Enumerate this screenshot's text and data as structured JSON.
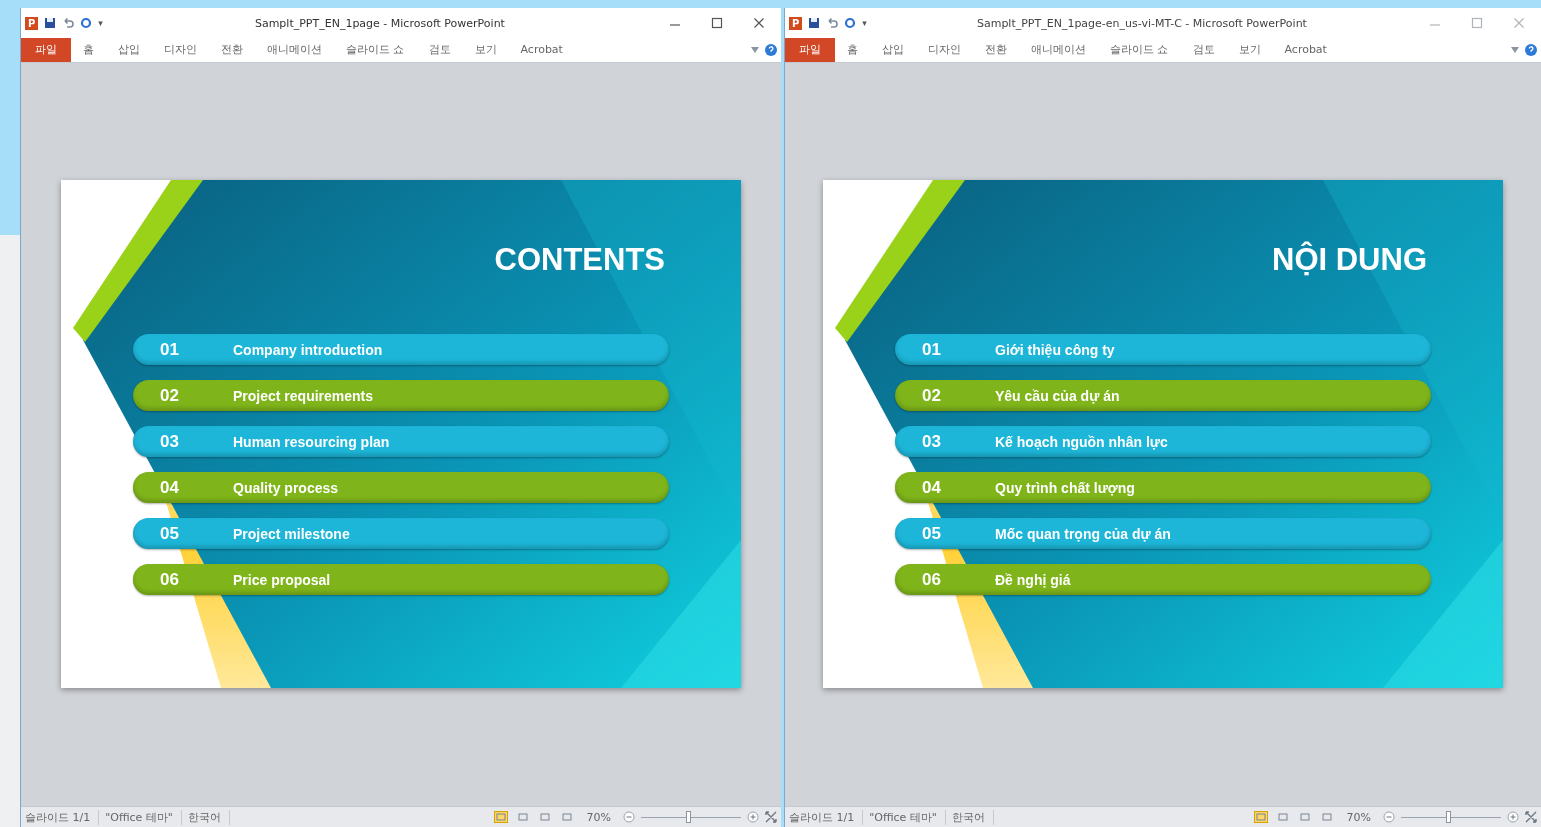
{
  "windows": [
    {
      "active": true,
      "app_icon": "P",
      "quick_access_more": "▾",
      "title": "Samplt_PPT_EN_1page - Microsoft PowerPoint",
      "ribbon_tabs": [
        {
          "label": "파일",
          "selected": true
        },
        {
          "label": "홈",
          "selected": false
        },
        {
          "label": "삽입",
          "selected": false
        },
        {
          "label": "디자인",
          "selected": false
        },
        {
          "label": "전환",
          "selected": false
        },
        {
          "label": "애니메이션",
          "selected": false
        },
        {
          "label": "슬라이드 쇼",
          "selected": false
        },
        {
          "label": "검토",
          "selected": false
        },
        {
          "label": "보기",
          "selected": false
        },
        {
          "label": "Acrobat",
          "selected": false
        }
      ],
      "slide": {
        "title": "CONTENTS",
        "items": [
          {
            "number": "01",
            "label": "Company introduction",
            "color": "#1db6d8"
          },
          {
            "number": "02",
            "label": "Project requirements",
            "color": "#7fb51a"
          },
          {
            "number": "03",
            "label": "Human resourcing plan",
            "color": "#1db6d8"
          },
          {
            "number": "04",
            "label": "Quality process",
            "color": "#7fb51a"
          },
          {
            "number": "05",
            "label": "Project milestone",
            "color": "#1db6d8"
          },
          {
            "number": "06",
            "label": "Price proposal",
            "color": "#7fb51a"
          }
        ]
      },
      "status": {
        "slide": "슬라이드 1/1",
        "theme": "\"Office 테마\"",
        "language": "한국어",
        "views": [
          {
            "selected": true
          },
          {
            "selected": false
          },
          {
            "selected": false
          },
          {
            "selected": false
          }
        ],
        "zoom": "70%",
        "zoom_slider": {
          "level": 0.45
        }
      }
    },
    {
      "active": false,
      "app_icon": "P",
      "quick_access_more": "▾",
      "title": "Samplt_PPT_EN_1page-en_us-vi-MT-C - Microsoft PowerPoint",
      "ribbon_tabs": [
        {
          "label": "파일",
          "selected": true
        },
        {
          "label": "홈",
          "selected": false
        },
        {
          "label": "삽입",
          "selected": false
        },
        {
          "label": "디자인",
          "selected": false
        },
        {
          "label": "전환",
          "selected": false
        },
        {
          "label": "애니메이션",
          "selected": false
        },
        {
          "label": "슬라이드 쇼",
          "selected": false
        },
        {
          "label": "검토",
          "selected": false
        },
        {
          "label": "보기",
          "selected": false
        },
        {
          "label": "Acrobat",
          "selected": false
        }
      ],
      "slide": {
        "title": "NỘI DUNG",
        "items": [
          {
            "number": "01",
            "label": "Giới thiệu công ty",
            "color": "#1db6d8"
          },
          {
            "number": "02",
            "label": "Yêu cầu của dự án",
            "color": "#7fb51a"
          },
          {
            "number": "03",
            "label": "Kế hoạch nguồn nhân lực",
            "color": "#1db6d8"
          },
          {
            "number": "04",
            "label": "Quy trình chất lượng",
            "color": "#7fb51a"
          },
          {
            "number": "05",
            "label": "Mốc quan trọng của dự án",
            "color": "#1db6d8"
          },
          {
            "number": "06",
            "label": "Đề nghị giá",
            "color": "#7fb51a"
          }
        ]
      },
      "status": {
        "slide": "슬라이드 1/1",
        "theme": "\"Office 테마\"",
        "language": "한국어",
        "views": [
          {
            "selected": true
          },
          {
            "selected": false
          },
          {
            "selected": false
          },
          {
            "selected": false
          }
        ],
        "zoom": "70%",
        "zoom_slider": {
          "level": 0.45
        }
      }
    }
  ]
}
